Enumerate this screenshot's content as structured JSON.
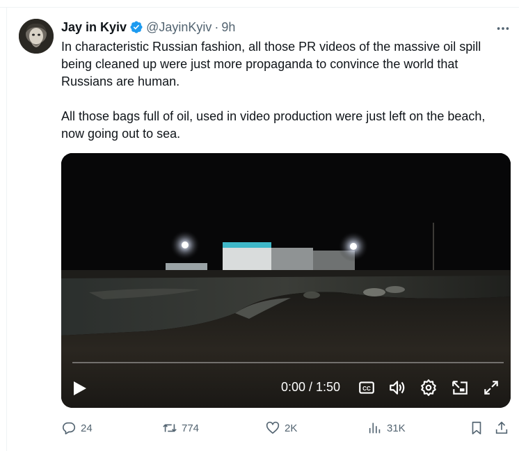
{
  "tweet": {
    "author": {
      "display_name": "Jay in Kyiv",
      "handle": "@JayinKyiv",
      "separator": "·",
      "time": "9h"
    },
    "more_icon": "more-horizontal-icon",
    "text": {
      "paragraph1": "In characteristic Russian fashion, all those PR videos of the massive oil spill being cleaned up were just more propaganda to convince the world that Russians are human.",
      "paragraph2": "All those bags full of oil, used in video production were just left on the beach, now going out to sea."
    },
    "video": {
      "time_readout": "0:00 / 1:50",
      "progress": 0,
      "controls": [
        "play-icon",
        "captions-icon",
        "volume-icon",
        "settings-icon",
        "pip-icon",
        "fullscreen-icon"
      ]
    },
    "actions": {
      "replies": "24",
      "retweets": "774",
      "likes": "2K",
      "views": "31K"
    },
    "colors": {
      "text": "#0f1419",
      "secondary": "#536471",
      "verified": "#1d9bf0",
      "progress": "#1d9bf0"
    }
  }
}
